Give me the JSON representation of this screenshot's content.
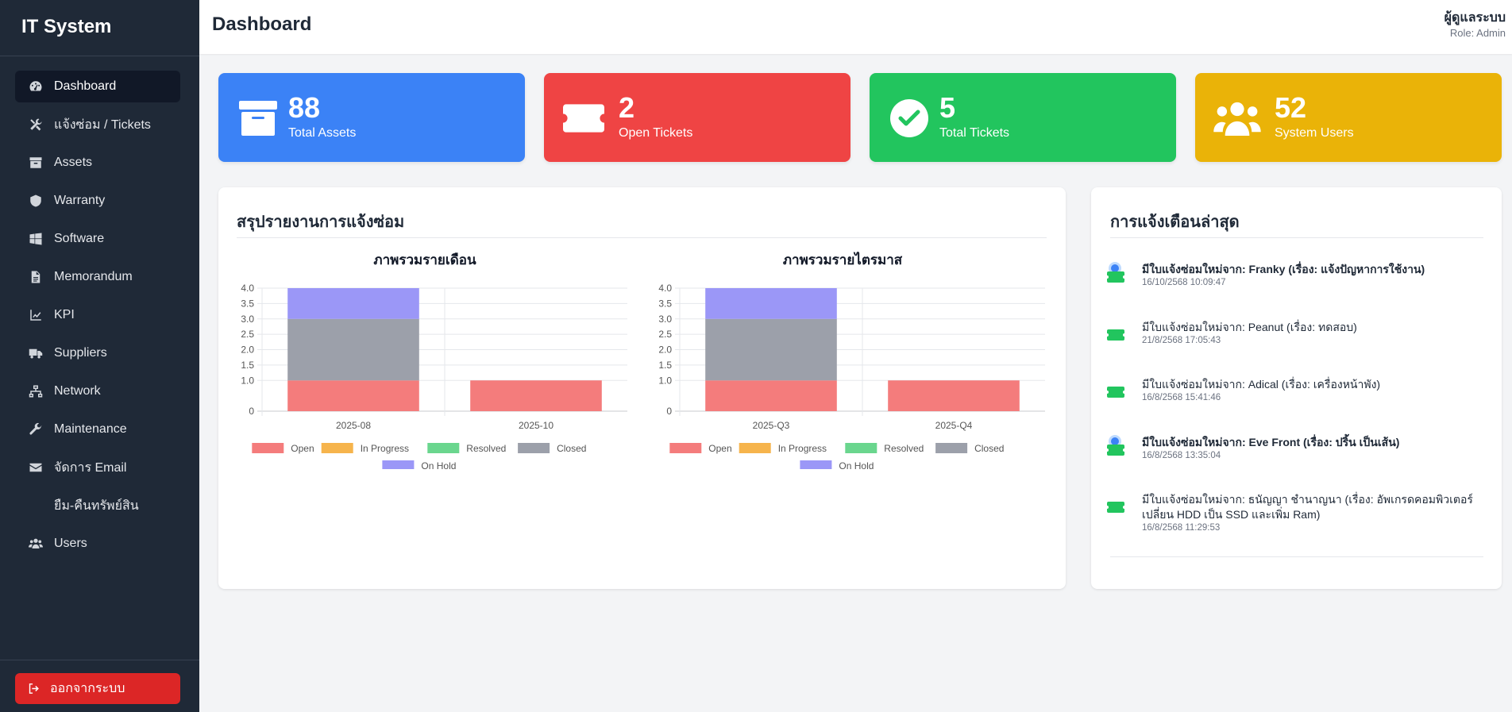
{
  "app": {
    "brand": "IT System"
  },
  "sidebar": {
    "items": [
      {
        "label": "Dashboard",
        "icon": "gauge-icon",
        "active": true
      },
      {
        "label": "แจ้งซ่อม / Tickets",
        "icon": "tools-icon"
      },
      {
        "label": "Assets",
        "icon": "archive-icon"
      },
      {
        "label": "Warranty",
        "icon": "shield-icon"
      },
      {
        "label": "Software",
        "icon": "windows-icon"
      },
      {
        "label": "Memorandum",
        "icon": "file-icon"
      },
      {
        "label": "KPI",
        "icon": "line-chart-icon"
      },
      {
        "label": "Suppliers",
        "icon": "truck-icon"
      },
      {
        "label": "Network",
        "icon": "network-icon"
      },
      {
        "label": "Maintenance",
        "icon": "wrench-icon"
      },
      {
        "label": "จัดการ Email",
        "icon": "envelope-icon"
      },
      {
        "label": "ยืม-คืนทรัพย์สิน",
        "icon": ""
      },
      {
        "label": "Users",
        "icon": "users-icon"
      }
    ],
    "logout_label": "ออกจากระบบ"
  },
  "header": {
    "title": "Dashboard",
    "user_name": "ผู้ดูแลระบบ",
    "user_role": "Role: Admin"
  },
  "stats": [
    {
      "value": "88",
      "label": "Total Assets",
      "color": "#3b82f6",
      "icon": "archive-icon"
    },
    {
      "value": "2",
      "label": "Open Tickets",
      "color": "#ef4444",
      "icon": "ticket-icon"
    },
    {
      "value": "5",
      "label": "Total Tickets",
      "color": "#22c55e",
      "icon": "check-circle-icon"
    },
    {
      "value": "52",
      "label": "System Users",
      "color": "#eab308",
      "icon": "users-icon"
    }
  ],
  "report": {
    "title": "สรุปรายงานการแจ้งซ่อม"
  },
  "chart_data": [
    {
      "type": "bar",
      "stacked": true,
      "title": "ภาพรวมรายเดือน",
      "categories": [
        "2025-08",
        "2025-10"
      ],
      "ylim": [
        0,
        4
      ],
      "yticks": [
        "0",
        "1.0",
        "1.5",
        "2.0",
        "2.5",
        "3.0",
        "3.5",
        "4.0"
      ],
      "grid": true,
      "legend_position": "bottom",
      "series": [
        {
          "name": "Open",
          "values": [
            1,
            1
          ],
          "color": "#f47c7c"
        },
        {
          "name": "In Progress",
          "values": [
            0,
            0
          ],
          "color": "#f6b44c"
        },
        {
          "name": "Resolved",
          "values": [
            0,
            0
          ],
          "color": "#6ad68e"
        },
        {
          "name": "Closed",
          "values": [
            2,
            0
          ],
          "color": "#9ca0aa"
        },
        {
          "name": "On Hold",
          "values": [
            1,
            0
          ],
          "color": "#9b97f7"
        }
      ]
    },
    {
      "type": "bar",
      "stacked": true,
      "title": "ภาพรวมรายไตรมาส",
      "categories": [
        "2025-Q3",
        "2025-Q4"
      ],
      "ylim": [
        0,
        4
      ],
      "yticks": [
        "0",
        "1.0",
        "1.5",
        "2.0",
        "2.5",
        "3.0",
        "3.5",
        "4.0"
      ],
      "grid": true,
      "legend_position": "bottom",
      "series": [
        {
          "name": "Open",
          "values": [
            1,
            1
          ],
          "color": "#f47c7c"
        },
        {
          "name": "In Progress",
          "values": [
            0,
            0
          ],
          "color": "#f6b44c"
        },
        {
          "name": "Resolved",
          "values": [
            0,
            0
          ],
          "color": "#6ad68e"
        },
        {
          "name": "Closed",
          "values": [
            2,
            0
          ],
          "color": "#9ca0aa"
        },
        {
          "name": "On Hold",
          "values": [
            1,
            0
          ],
          "color": "#9b97f7"
        }
      ]
    }
  ],
  "notifications": {
    "title": "การแจ้งเตือนล่าสุด",
    "items": [
      {
        "text": "มีใบแจ้งซ่อมใหม่จาก: Franky (เรื่อง: แจ้งปัญหาการใช้งาน)",
        "time": "16/10/2568 10:09:47",
        "unread": true
      },
      {
        "text": "มีใบแจ้งซ่อมใหม่จาก: Peanut (เรื่อง: ทดสอบ)",
        "time": "21/8/2568 17:05:43",
        "unread": false
      },
      {
        "text": "มีใบแจ้งซ่อมใหม่จาก: Adical (เรื่อง: เครื่องหน้าพัง)",
        "time": "16/8/2568 15:41:46",
        "unread": false
      },
      {
        "text": "มีใบแจ้งซ่อมใหม่จาก: Eve Front (เรื่อง: ปริ้น เป็นเส้น)",
        "time": "16/8/2568 13:35:04",
        "unread": true
      },
      {
        "text": "มีใบแจ้งซ่อมใหม่จาก: ธนัญญา ชำนาญนา (เรื่อง: อัพเกรดคอมพิวเตอร์ เปลี่ยน HDD เป็น SSD และเพิ่ม Ram)",
        "time": "16/8/2568 11:29:53",
        "unread": false
      }
    ]
  }
}
